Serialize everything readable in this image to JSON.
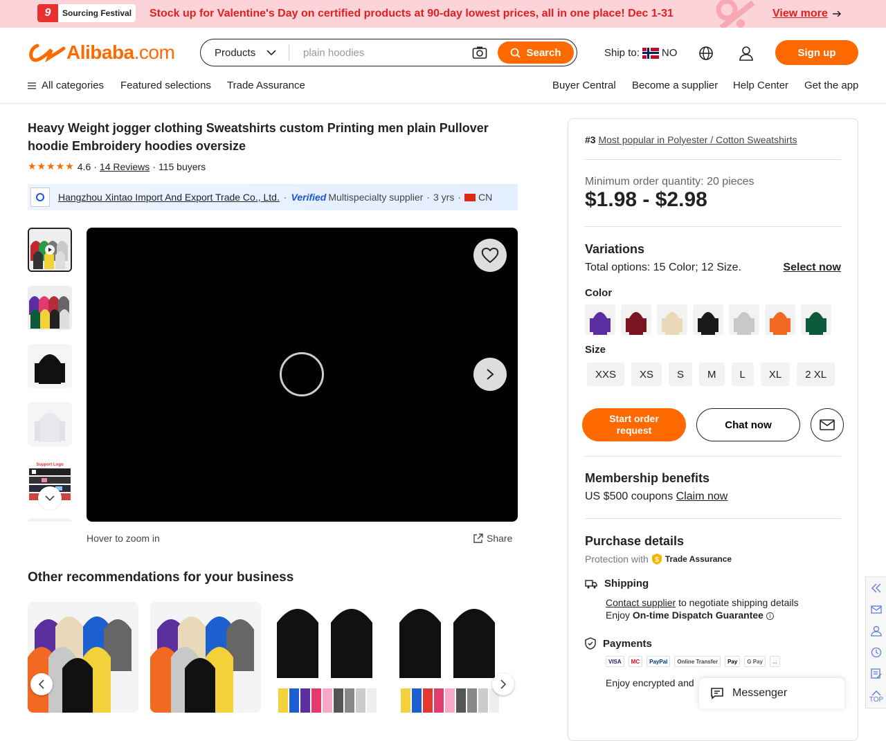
{
  "banner": {
    "festival_num": "9",
    "festival_label": "Sourcing Festival",
    "message": "Stock up for Valentine's Day on certified products at 90-day lowest prices, all in one place! Dec 1-31",
    "view_more": "View more"
  },
  "header": {
    "logo": "Alibaba",
    "logo_suffix": ".com",
    "search": {
      "category": "Products",
      "placeholder": "plain hoodies",
      "button": "Search"
    },
    "ship_to_label": "Ship to:",
    "ship_to_country": "NO",
    "signup": "Sign up"
  },
  "nav": {
    "all_categories": "All categories",
    "featured": "Featured selections",
    "trade_assurance": "Trade Assurance",
    "buyer_central": "Buyer Central",
    "become_supplier": "Become a supplier",
    "help_center": "Help Center",
    "get_app": "Get the app"
  },
  "product": {
    "title": "Heavy Weight jogger clothing Sweatshirts custom Printing men plain Pullover hoodie Embroidery hoodies oversize",
    "rating": "4.6",
    "reviews": "14 Reviews",
    "buyers": "115 buyers",
    "supplier_name": "Hangzhou Xintao Import And Export Trade Co., Ltd.",
    "verified": "Verified",
    "supplier_type": "Multispecialty supplier",
    "years": "3 yrs",
    "country": "CN",
    "thumb_label": "Support Logo",
    "hover_zoom": "Hover to zoom in",
    "share": "Share"
  },
  "recommendations": {
    "title": "Other recommendations for your business"
  },
  "panel": {
    "rank_num": "#3",
    "rank_text": "Most popular in Polyester / Cotton Sweatshirts",
    "moq": "Minimum order quantity: 20 pieces",
    "price": "$1.98 - $2.98",
    "variations_title": "Variations",
    "total_options": "Total options: 15 Color; 12 Size.",
    "select_now": "Select now",
    "color_label": "Color",
    "colors": [
      "#5b2fa0",
      "#7a1420",
      "#e9d9b8",
      "#1a1a1a",
      "#c8c8c8",
      "#f26a21",
      "#0c5b3c"
    ],
    "size_label": "Size",
    "sizes": [
      "XXS",
      "XS",
      "S",
      "M",
      "L",
      "XL",
      "2 XL"
    ],
    "start_order": "Start order request",
    "chat_now": "Chat now",
    "membership_title": "Membership benefits",
    "coupon_text": "US $500 coupons",
    "claim_now": "Claim now",
    "purchase_title": "Purchase details",
    "protection": "Protection with",
    "trade_assurance": "Trade Assurance",
    "shipping_label": "Shipping",
    "contact_supplier": "Contact supplier",
    "shipping_text": "to negotiate shipping details",
    "enjoy": "Enjoy",
    "dispatch": "On-time Dispatch Guarantee",
    "payments_label": "Payments",
    "pay_logos": [
      "VISA",
      "MC",
      "PayPal",
      "Online Transfer",
      "Pay",
      "G Pay",
      "..."
    ],
    "encrypted": "Enjoy encrypted and"
  },
  "sidebar": {
    "top": "TOP"
  },
  "messenger": "Messenger"
}
